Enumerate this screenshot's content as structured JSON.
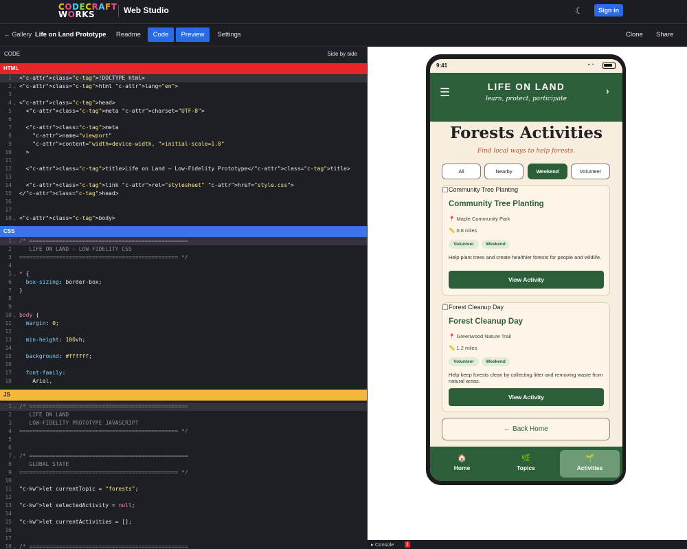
{
  "topbar": {
    "logo_line1": "CODECRAFT",
    "logo_line2": "WORKS",
    "studio": "Web Studio",
    "signin": "Sign in"
  },
  "secbar": {
    "back": "← Gallery",
    "project_title": "Life on Land Prototype",
    "tabs": [
      "Readme",
      "Code",
      "Preview",
      "Settings"
    ],
    "active_tabs": [
      "Code",
      "Preview"
    ],
    "clone": "Clone",
    "share": "Share"
  },
  "editor": {
    "header_label": "CODE",
    "header_mode": "Side by side",
    "html_label": "HTML",
    "css_label": "CSS",
    "js_label": "JS",
    "colors": {
      "html": "#e5252a",
      "css": "#3b74e6",
      "js": "#f6b73c"
    },
    "html_lines": [
      {
        "n": "1",
        "t": "<!DOCTYPE html>"
      },
      {
        "n": "2",
        "t": "<html lang=\"en\">"
      },
      {
        "n": "3",
        "t": ""
      },
      {
        "n": "4",
        "t": "<head>"
      },
      {
        "n": "5",
        "t": "  <meta charset=\"UTF-8\">"
      },
      {
        "n": "6",
        "t": ""
      },
      {
        "n": "7",
        "t": "  <meta"
      },
      {
        "n": "8",
        "t": "    name=\"viewport\""
      },
      {
        "n": "9",
        "t": "    content=\"width=device-width, initial-scale=1.0\""
      },
      {
        "n": "10",
        "t": "  >"
      },
      {
        "n": "11",
        "t": ""
      },
      {
        "n": "12",
        "t": "  <title>Life on Land – Low-Fidelity Prototype</title>"
      },
      {
        "n": "13",
        "t": ""
      },
      {
        "n": "14",
        "t": "  <link rel=\"stylesheet\" href=\"style.css\">"
      },
      {
        "n": "15",
        "t": "</head>"
      },
      {
        "n": "16",
        "t": ""
      },
      {
        "n": "17",
        "t": ""
      },
      {
        "n": "18",
        "t": "<body>"
      }
    ],
    "css_lines": [
      {
        "n": "1",
        "t": "/* ================================================"
      },
      {
        "n": "2",
        "t": "   LIFE ON LAND – LOW-FIDELITY CSS"
      },
      {
        "n": "3",
        "t": "================================================ */"
      },
      {
        "n": "4",
        "t": ""
      },
      {
        "n": "5",
        "t": "* {"
      },
      {
        "n": "6",
        "t": "  box-sizing: border-box;"
      },
      {
        "n": "7",
        "t": "}"
      },
      {
        "n": "8",
        "t": ""
      },
      {
        "n": "9",
        "t": ""
      },
      {
        "n": "10",
        "t": "body {"
      },
      {
        "n": "11",
        "t": "  margin: 0;"
      },
      {
        "n": "12",
        "t": ""
      },
      {
        "n": "13",
        "t": "  min-height: 100vh;"
      },
      {
        "n": "14",
        "t": ""
      },
      {
        "n": "15",
        "t": "  background: #ffffff;"
      },
      {
        "n": "16",
        "t": ""
      },
      {
        "n": "17",
        "t": "  font-family:"
      },
      {
        "n": "18",
        "t": "    Arial,"
      }
    ],
    "js_lines": [
      {
        "n": "1",
        "t": "/* ================================================"
      },
      {
        "n": "2",
        "t": "   LIFE ON LAND"
      },
      {
        "n": "3",
        "t": "   LOW-FIDELITY PROTOTYPE JAVASCRIPT"
      },
      {
        "n": "4",
        "t": "================================================ */"
      },
      {
        "n": "5",
        "t": ""
      },
      {
        "n": "6",
        "t": ""
      },
      {
        "n": "7",
        "t": "/* ================================================"
      },
      {
        "n": "8",
        "t": "   GLOBAL STATE"
      },
      {
        "n": "9",
        "t": "================================================ */"
      },
      {
        "n": "10",
        "t": ""
      },
      {
        "n": "11",
        "t": "let currentTopic = \"forests\";"
      },
      {
        "n": "12",
        "t": ""
      },
      {
        "n": "13",
        "t": "let selectedActivity = null;"
      },
      {
        "n": "14",
        "t": ""
      },
      {
        "n": "15",
        "t": "let currentActivities = [];"
      },
      {
        "n": "16",
        "t": ""
      },
      {
        "n": "17",
        "t": ""
      },
      {
        "n": "18",
        "t": "/* ================================================"
      }
    ]
  },
  "console": {
    "label": "Console",
    "count": "1"
  },
  "phone": {
    "time": "9:41",
    "app_title": "LIFE ON LAND",
    "app_tagline": "learn, protect, participate",
    "page_title": "Forests Activities",
    "page_subtitle": "Find local ways to help forests.",
    "filters": [
      "All",
      "Nearby",
      "Weekend",
      "Volunteer"
    ],
    "active_filter": "Weekend",
    "cards": [
      {
        "img_alt": "Community Tree Planting",
        "title": "Community Tree Planting",
        "location": "Maple Community Park",
        "distance": "0.8 miles",
        "tags": [
          "Volunteer",
          "Weekend"
        ],
        "description": "Help plant trees and create healthier forests for people and wildlife.",
        "button": "View Activity"
      },
      {
        "img_alt": "Forest Cleanup Day",
        "title": "Forest Cleanup Day",
        "location": "Greenwood Nature Trail",
        "distance": "1.2 miles",
        "tags": [
          "Volunteer",
          "Weekend"
        ],
        "description": "Help keep forests clean by collecting litter and removing waste from natural areas.",
        "button": "View Activity"
      }
    ],
    "back_home": "← Back Home",
    "nav": [
      {
        "label": "Home",
        "icon": "house-icon",
        "glyph": "🏠"
      },
      {
        "label": "Topics",
        "icon": "sprout-icon",
        "glyph": "🌿"
      },
      {
        "label": "Activities",
        "icon": "leaf-icon",
        "glyph": "🌱"
      }
    ],
    "active_nav": "Activities",
    "colors": {
      "header": "#2c5e3a",
      "background": "#f7eee0",
      "accent": "#c0562a"
    }
  }
}
